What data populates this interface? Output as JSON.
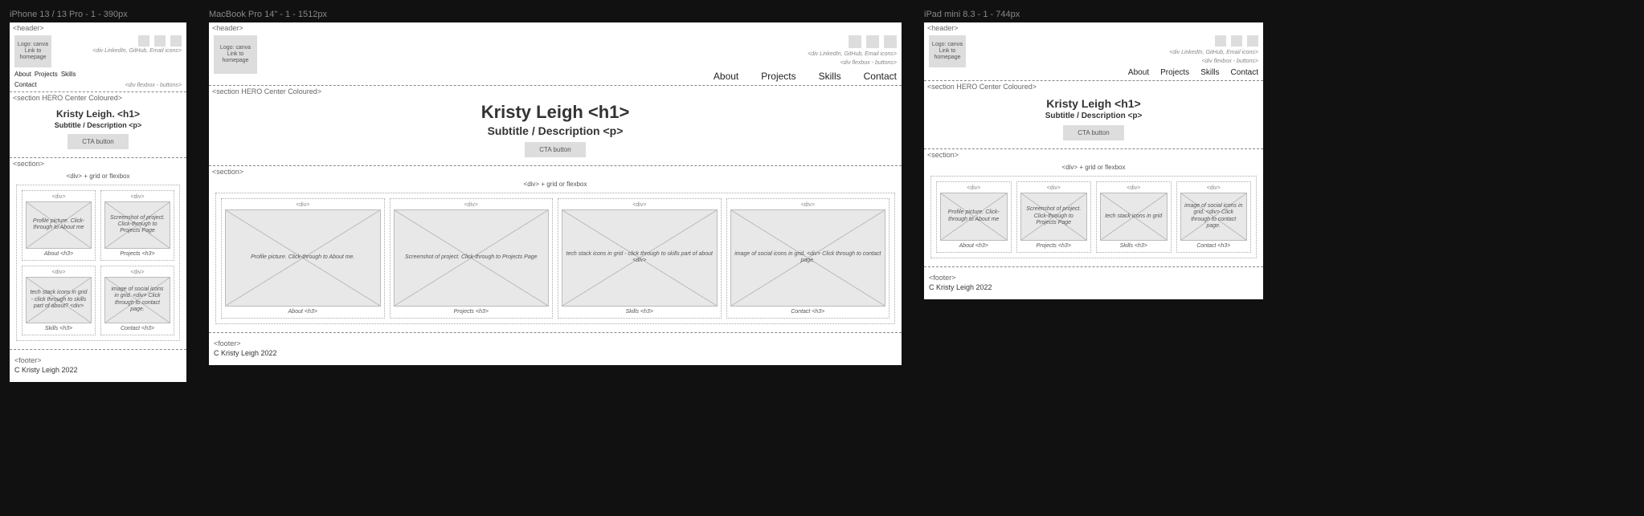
{
  "frames": {
    "phone": {
      "label": "iPhone 13 / 13 Pro - 1 - 390px"
    },
    "desktop": {
      "label": "MacBook Pro 14\" - 1 - 1512px"
    },
    "tablet": {
      "label": "iPad mini 8.3 - 1 - 744px"
    }
  },
  "tags": {
    "header": "<header>",
    "hero": "<section HERO Center Coloured>",
    "section": "<section>",
    "div": "<div>",
    "footer": "<footer>",
    "gridnote": "<div> + grid or flexbox"
  },
  "logo": "Logo: canva Link to homepage",
  "social_caption": "<div LinkedIn, GitHub, Email icons>",
  "nav_caption": "<div flexbox - buttons>",
  "nav": {
    "about": "About",
    "projects": "Projects",
    "skills": "Skills",
    "contact": "Contact"
  },
  "hero": {
    "h1_phone": "Kristy Leigh. <h1>",
    "h1": "Kristy Leigh <h1>",
    "sub": "Subtitle / Description <p>",
    "cta": "CTA button"
  },
  "cards": {
    "about": {
      "desc": "Profile picture. Click-through to About me.",
      "desc_sm": "Profile picture. Click-through to About me",
      "title": "About <h3>"
    },
    "projects": {
      "desc": "Screenshot of project. Click-through to Projects Page",
      "title": "Projects <h3>"
    },
    "skills": {
      "desc_lg": "tech stack icons in grid - click through to skills part of about <div>",
      "desc_md": "tech stack icons in grid",
      "desc_sm": "tech stack icons in grid - click through to skills part of about? <div>",
      "title": "Skills <h3>"
    },
    "contact": {
      "desc": "image of social icons in grid. <div> Click through to contact page.",
      "title": "Contact <h3>"
    }
  },
  "footer": "C Kristy Leigh 2022"
}
